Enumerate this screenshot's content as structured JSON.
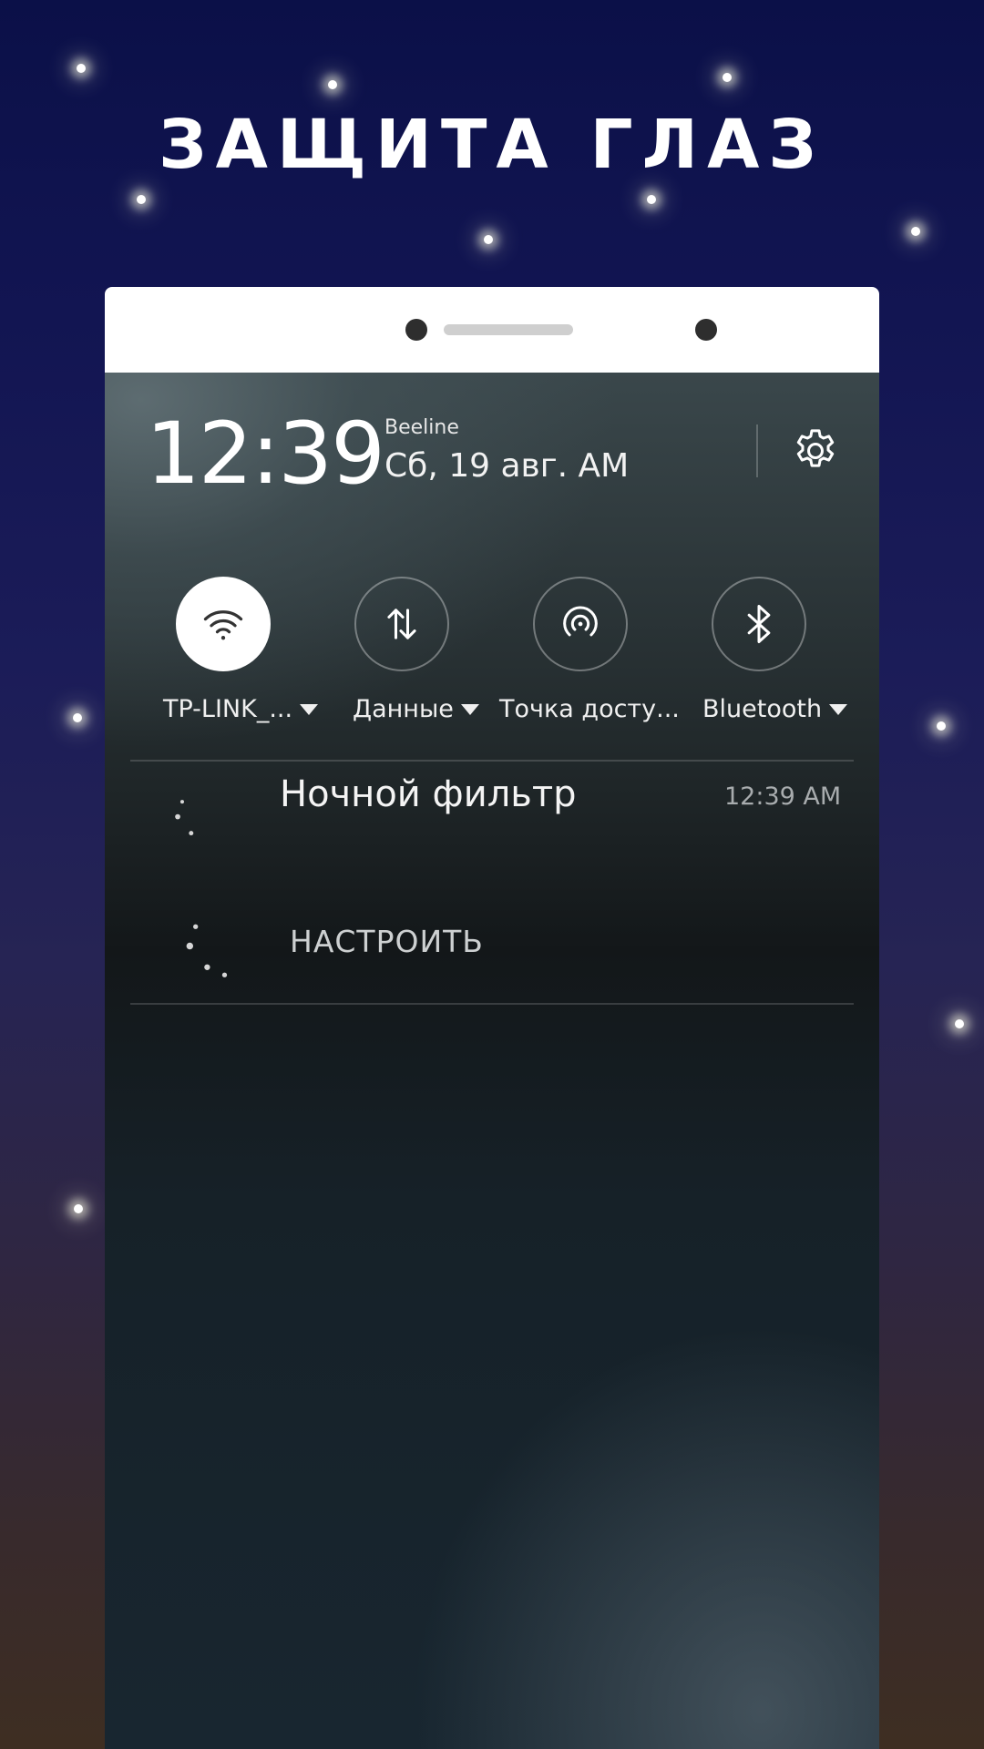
{
  "promo": {
    "headline": "ЗАЩИТА ГЛАЗ"
  },
  "status": {
    "time": "12:39",
    "carrier": "Beeline",
    "date": "Сб, 19 авг. AM"
  },
  "toggles": [
    {
      "label": "TP-LINK_...",
      "icon": "wifi-icon",
      "active": true,
      "has_dropdown": true
    },
    {
      "label": "Данные",
      "icon": "data-transfer-icon",
      "active": false,
      "has_dropdown": true
    },
    {
      "label": "Точка досту...",
      "icon": "hotspot-icon",
      "active": false,
      "has_dropdown": false
    },
    {
      "label": "Bluetooth",
      "icon": "bluetooth-icon",
      "active": false,
      "has_dropdown": true
    }
  ],
  "notification": {
    "icon": "moon-icon",
    "title": "Ночной фильтр",
    "time": "12:39 AM",
    "action_label": "НАСТРОИТЬ"
  },
  "colors": {
    "background_top": "#0b1048",
    "background_bottom": "#3e2e22",
    "panel": "#1a2226",
    "active_toggle": "#ffffff"
  }
}
